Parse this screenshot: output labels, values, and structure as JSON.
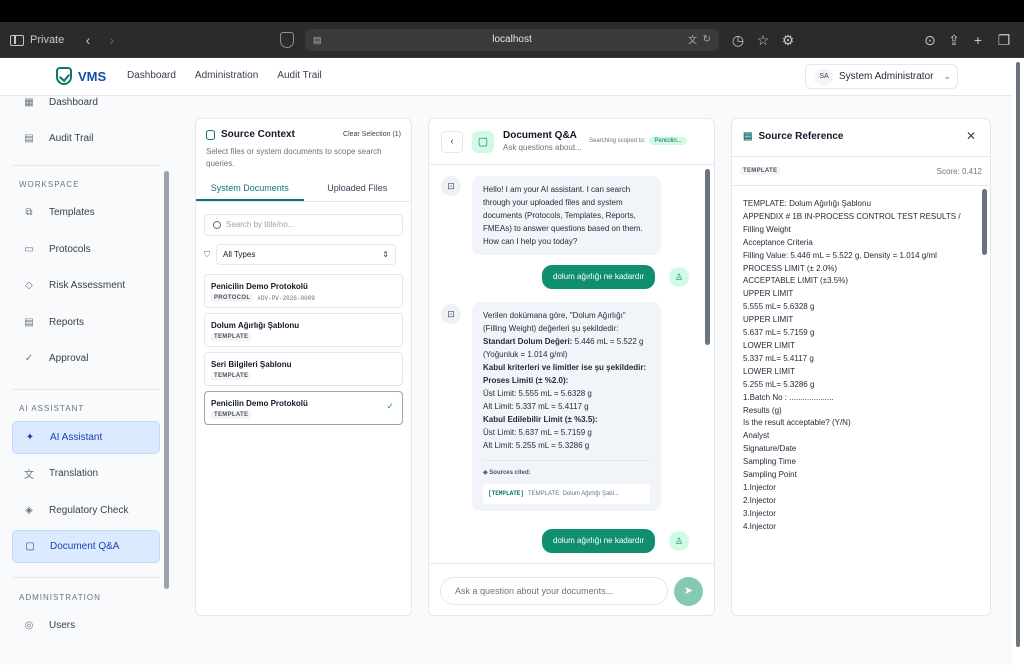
{
  "browser": {
    "private_label": "Private",
    "url": "localhost"
  },
  "header": {
    "brand": "VMS",
    "nav": [
      "Dashboard",
      "Administration",
      "Audit Trail"
    ],
    "user_initials": "SA",
    "user_name": "System Administrator"
  },
  "sidebar": {
    "top_items": [
      {
        "label": "Dashboard"
      },
      {
        "label": "Audit Trail"
      }
    ],
    "workspace_label": "WORKSPACE",
    "workspace_items": [
      {
        "label": "Templates"
      },
      {
        "label": "Protocols"
      },
      {
        "label": "Risk Assessment"
      },
      {
        "label": "Reports"
      },
      {
        "label": "Approval"
      }
    ],
    "ai_label": "AI ASSISTANT",
    "ai_items": [
      {
        "label": "AI Assistant",
        "active": true
      },
      {
        "label": "Translation"
      },
      {
        "label": "Regulatory Check"
      },
      {
        "label": "Document Q&A",
        "active": true
      }
    ],
    "admin_label": "ADMINISTRATION",
    "admin_items": [
      {
        "label": "Users"
      }
    ]
  },
  "source_context": {
    "title": "Source Context",
    "clear_label": "Clear Selection (1)",
    "description": "Select files or system documents to scope search queries.",
    "tabs": [
      "System Documents",
      "Uploaded Files"
    ],
    "search_placeholder": "Search by title/no...",
    "filter_value": "All Types",
    "documents": [
      {
        "name": "Penicilin Demo Protokolü",
        "type": "PROTOCOL",
        "code": "#DV-PV-2026-0009",
        "selected": false
      },
      {
        "name": "Dolum Ağırlığı Şablonu",
        "type": "TEMPLATE",
        "code": "",
        "selected": false
      },
      {
        "name": "Seri Bilgileri Şablonu",
        "type": "TEMPLATE",
        "code": "",
        "selected": false
      },
      {
        "name": "Penicilin Demo Protokolü",
        "type": "TEMPLATE",
        "code": "",
        "selected": true
      }
    ]
  },
  "chat": {
    "title": "Document Q&A",
    "subtitle": "Ask questions about...",
    "scoped_label": "Searching scoped to:",
    "scoped_value": "Penicilin...",
    "messages": {
      "greeting": "Hello! I am your AI assistant. I can search through your uploaded files and system documents (Protocols, Templates, Reports, FMEAs) to answer questions based on them. How can I help you today?",
      "user_q1": "dolum ağırlığı ne kadardır",
      "answer_intro": "Verilen dokümana göre, \"Dolum Ağırlığı\" (Filling Weight) değerleri şu şekildedir:",
      "answer_std_label": "Standart Dolum Değeri:",
      "answer_std_value": "5.446 mL = 5.522 g (Yoğunluk = 1.014 g/ml)",
      "answer_criteria": "Kabul kriterleri ve limitler ise şu şekildedir:",
      "answer_proc_label": "Proses Limiti (± %2.0):",
      "answer_proc_upper": "Üst Limit: 5.555 mL = 5.6328 g",
      "answer_proc_lower": "Alt Limit: 5.337 mL = 5.4117 g",
      "answer_acc_label": "Kabul Edilebilir Limit (± %3.5):",
      "answer_acc_upper": "Üst Limit: 5.637 mL = 5.7159 g",
      "answer_acc_lower": "Alt Limit: 5.255 mL = 5.3286 g",
      "sources_label": "Sources cited:",
      "source_tag": "[TEMPLATE]",
      "source_text": "TEMPLATE: Dolum Ağırlığı Şabl...",
      "user_q2": "dolum ağırlığı ne kadardır"
    },
    "input_placeholder": "Ask a question about your documents..."
  },
  "source_reference": {
    "title": "Source Reference",
    "type": "TEMPLATE",
    "score": "Score: 0.412",
    "lines": [
      "TEMPLATE: Dolum Ağırlığı Şablonu",
      "APPENDIX # 1B IN-PROCESS CONTROL TEST RESULTS / Filling Weight",
      "Acceptance Criteria",
      "Filling Value: 5.446 mL = 5.522 g, Density = 1.014 g/ml",
      "PROCESS LIMIT (± 2.0%)",
      "ACCEPTABLE LIMIT (±3.5%)",
      "UPPER LIMIT",
      "5.555 mL= 5.6328 g",
      "UPPER LIMIT",
      "5.637 mL= 5.7159 g",
      "LOWER LIMIT",
      "5.337 mL= 5.4117 g",
      "LOWER LIMIT",
      "5.255 mL= 5.3286 g",
      "1.Batch No : ....................",
      "Results (g)",
      "Is the result acceptable? (Y/N)",
      "Analyst",
      "Signature/Date",
      "Sampling Time",
      "Sampling Point",
      "1.Injector",
      "2.Injector",
      "3.Injector",
      "4.Injector"
    ]
  }
}
